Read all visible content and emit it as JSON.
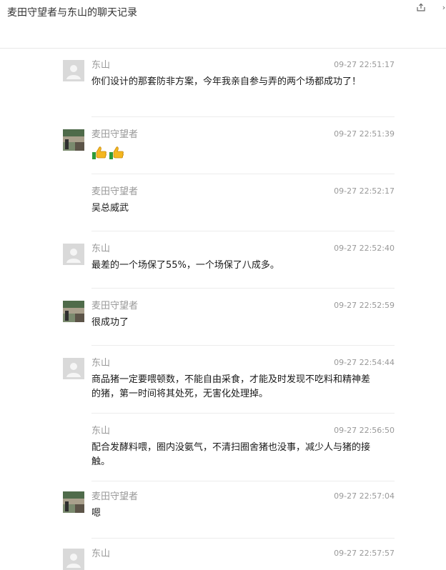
{
  "window": {
    "title": "麦田守望者与东山的聊天记录",
    "share_icon": "share-icon",
    "next_icon": "chevron-right-icon",
    "next_glyph": "›"
  },
  "messages": [
    {
      "sender": "东山",
      "time": "09-27 22:51:17",
      "text": "你们设计的那套防非方案，今年我亲自参与弄的两个场都成功了！",
      "avatar": "default-avatar"
    },
    {
      "sender": "麦田守望者",
      "time": "09-27 22:51:39",
      "text": "",
      "emojis": [
        "thumbs-up-icon",
        "thumbs-up-icon"
      ],
      "avatar": "photo-avatar"
    },
    {
      "sender": "麦田守望者",
      "time": "09-27 22:52:17",
      "text": "吴总威武"
    },
    {
      "sender": "东山",
      "time": "09-27 22:52:40",
      "text": "最差的一个场保了55%，一个场保了八成多。",
      "avatar": "default-avatar"
    },
    {
      "sender": "麦田守望者",
      "time": "09-27 22:52:59",
      "text": "很成功了",
      "avatar": "photo-avatar"
    },
    {
      "sender": "东山",
      "time": "09-27 22:54:44",
      "text": "商品猪一定要喂顿数，不能自由采食，才能及时发现不吃料和精神差的猪，第一时间将其处死，无害化处理掉。",
      "avatar": "default-avatar"
    },
    {
      "sender": "东山",
      "time": "09-27 22:56:50",
      "text": "配合发酵料喂，圈内没氨气，不清扫圈舍猪也没事，减少人与猪的接触。"
    },
    {
      "sender": "麦田守望者",
      "time": "09-27 22:57:04",
      "text": "嗯",
      "avatar": "photo-avatar"
    },
    {
      "sender": "东山",
      "time": "09-27 22:57:57",
      "text": "",
      "avatar": "default-avatar"
    }
  ]
}
